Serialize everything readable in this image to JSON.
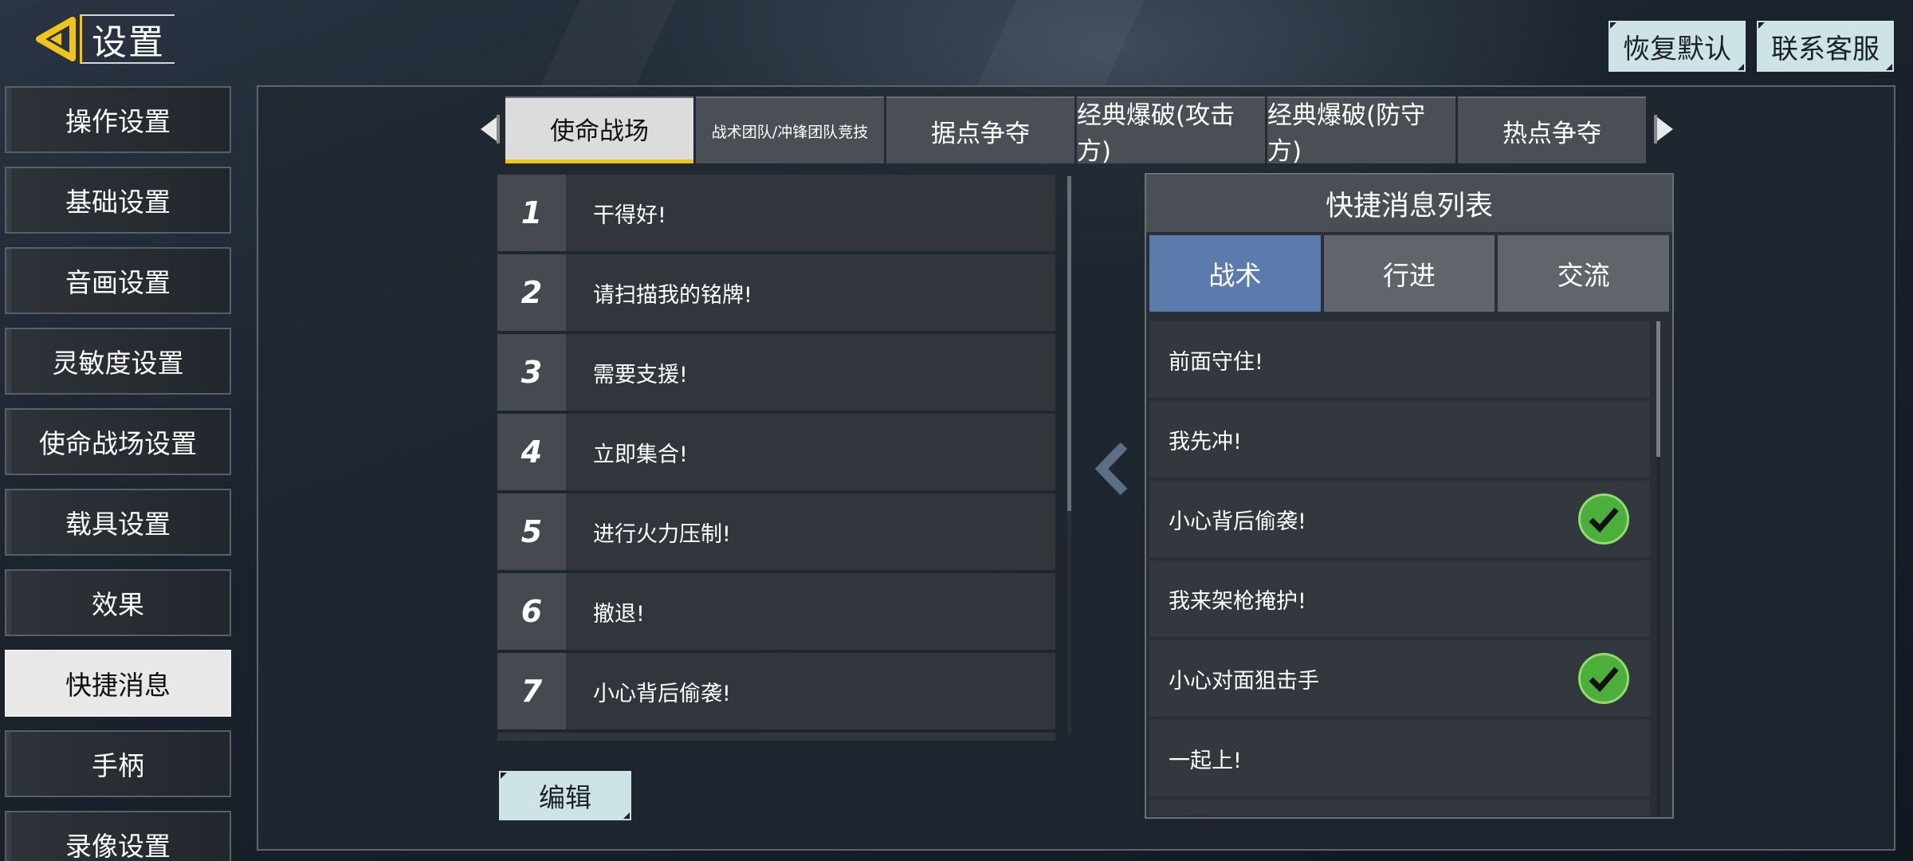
{
  "header": {
    "title": "设置"
  },
  "top_buttons": {
    "restore_default": "恢复默认",
    "contact_support": "联系客服"
  },
  "sidebar": {
    "items": [
      {
        "label": "操作设置"
      },
      {
        "label": "基础设置"
      },
      {
        "label": "音画设置"
      },
      {
        "label": "灵敏度设置"
      },
      {
        "label": "使命战场设置"
      },
      {
        "label": "载具设置"
      },
      {
        "label": "效果"
      },
      {
        "label": "快捷消息",
        "active": true
      },
      {
        "label": "手柄"
      },
      {
        "label": "录像设置"
      }
    ]
  },
  "mode_tabs": [
    {
      "label": "使命战场",
      "active": true
    },
    {
      "label": "战术团队/冲锋团队竞技"
    },
    {
      "label": "据点争夺"
    },
    {
      "label": "经典爆破(攻击方)"
    },
    {
      "label": "经典爆破(防守方)"
    },
    {
      "label": "热点争夺"
    }
  ],
  "message_slots": [
    {
      "num": "1",
      "text": "干得好!"
    },
    {
      "num": "2",
      "text": "请扫描我的铭牌!"
    },
    {
      "num": "3",
      "text": "需要支援!"
    },
    {
      "num": "4",
      "text": "立即集合!"
    },
    {
      "num": "5",
      "text": "进行火力压制!"
    },
    {
      "num": "6",
      "text": "撤退!"
    },
    {
      "num": "7",
      "text": "小心背后偷袭!"
    }
  ],
  "edit_button": "编辑",
  "quick_panel": {
    "title": "快捷消息列表",
    "tabs": [
      {
        "label": "战术",
        "active": true
      },
      {
        "label": "行进"
      },
      {
        "label": "交流"
      }
    ],
    "items": [
      {
        "text": "前面守住!",
        "selected": false
      },
      {
        "text": "我先冲!",
        "selected": false
      },
      {
        "text": "小心背后偷袭!",
        "selected": true
      },
      {
        "text": "我来架枪掩护!",
        "selected": false
      },
      {
        "text": "小心对面狙击手",
        "selected": true
      },
      {
        "text": "一起上!",
        "selected": false
      }
    ]
  },
  "colors": {
    "accent": "#f0c419",
    "active_tab_blue": "#5a7bab",
    "check_green": "#4caf3c"
  }
}
